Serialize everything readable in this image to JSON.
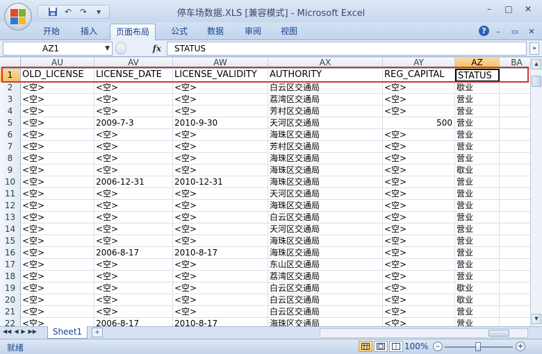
{
  "window": {
    "title": "停车场数据.XLS  [兼容模式] - Microsoft Excel",
    "minimize": "–",
    "maximize": "□",
    "close": "✕"
  },
  "qat": {
    "save": "💾",
    "undo": "↶",
    "redo": "↷",
    "customize": "▾"
  },
  "ribbon": {
    "tabs": [
      "开始",
      "插入",
      "页面布局",
      "公式",
      "数据",
      "审阅",
      "视图"
    ],
    "active_tab": "页面布局",
    "help": "?",
    "doc_minimize": "–",
    "doc_restore": "▭",
    "doc_close": "✕"
  },
  "formula_bar": {
    "name_box": "AZ1",
    "fx": "fx",
    "content": "STATUS",
    "expand": "»"
  },
  "grid": {
    "columns": [
      "AU",
      "AV",
      "AW",
      "AX",
      "AY",
      "AZ",
      "BA"
    ],
    "selected_column": "AZ",
    "rows": [
      [
        "1",
        "OLD_LICENSE",
        "LICENSE_DATE",
        "LICENSE_VALIDITY",
        "AUTHORITY",
        "REG_CAPITAL",
        "STATUS"
      ],
      [
        "2",
        "<空>",
        "<空>",
        "<空>",
        "白云区交通局",
        "<空>",
        "歇业"
      ],
      [
        "3",
        "<空>",
        "<空>",
        "<空>",
        "荔湾区交通局",
        "<空>",
        "营业"
      ],
      [
        "4",
        "<空>",
        "<空>",
        "<空>",
        "芳村区交通局",
        "<空>",
        "营业"
      ],
      [
        "5",
        "<空>",
        "2009-7-3",
        "2010-9-30",
        "天河区交通局",
        "500",
        "营业"
      ],
      [
        "6",
        "<空>",
        "<空>",
        "<空>",
        "海珠区交通局",
        "<空>",
        "营业"
      ],
      [
        "7",
        "<空>",
        "<空>",
        "<空>",
        "芳村区交通局",
        "<空>",
        "营业"
      ],
      [
        "8",
        "<空>",
        "<空>",
        "<空>",
        "海珠区交通局",
        "<空>",
        "营业"
      ],
      [
        "9",
        "<空>",
        "<空>",
        "<空>",
        "海珠区交通局",
        "<空>",
        "歇业"
      ],
      [
        "10",
        "<空>",
        "2006-12-31",
        "2010-12-31",
        "海珠区交通局",
        "<空>",
        "营业"
      ],
      [
        "11",
        "<空>",
        "<空>",
        "<空>",
        "天河区交通局",
        "<空>",
        "营业"
      ],
      [
        "12",
        "<空>",
        "<空>",
        "<空>",
        "海珠区交通局",
        "<空>",
        "营业"
      ],
      [
        "13",
        "<空>",
        "<空>",
        "<空>",
        "白云区交通局",
        "<空>",
        "营业"
      ],
      [
        "14",
        "<空>",
        "<空>",
        "<空>",
        "天河区交通局",
        "<空>",
        "营业"
      ],
      [
        "15",
        "<空>",
        "<空>",
        "<空>",
        "海珠区交通局",
        "<空>",
        "营业"
      ],
      [
        "16",
        "<空>",
        "2006-8-17",
        "2010-8-17",
        "海珠区交通局",
        "<空>",
        "营业"
      ],
      [
        "17",
        "<空>",
        "<空>",
        "<空>",
        "东山区交通局",
        "<空>",
        "营业"
      ],
      [
        "18",
        "<空>",
        "<空>",
        "<空>",
        "荔湾区交通局",
        "<空>",
        "营业"
      ],
      [
        "19",
        "<空>",
        "<空>",
        "<空>",
        "白云区交通局",
        "<空>",
        "歇业"
      ],
      [
        "20",
        "<空>",
        "<空>",
        "<空>",
        "白云区交通局",
        "<空>",
        "歇业"
      ],
      [
        "21",
        "<空>",
        "<空>",
        "<空>",
        "白云区交通局",
        "<空>",
        "营业"
      ],
      [
        "22",
        "<空>",
        "2006-8-17",
        "2010-8-17",
        "海珠区交通局",
        "<空>",
        "营业"
      ]
    ]
  },
  "sheets": {
    "tabs": [
      "Sheet1"
    ],
    "nav": [
      "◀◀",
      "◀",
      "▶",
      "▶▶"
    ],
    "new_sheet": "+"
  },
  "status_bar": {
    "ready": "就绪",
    "zoom": "100%",
    "zoom_out": "–",
    "zoom_in": "+"
  },
  "colors": {
    "selection_header": "#f1c15f",
    "highlight_frame": "#d4342e",
    "ribbon_text": "#15428b"
  }
}
